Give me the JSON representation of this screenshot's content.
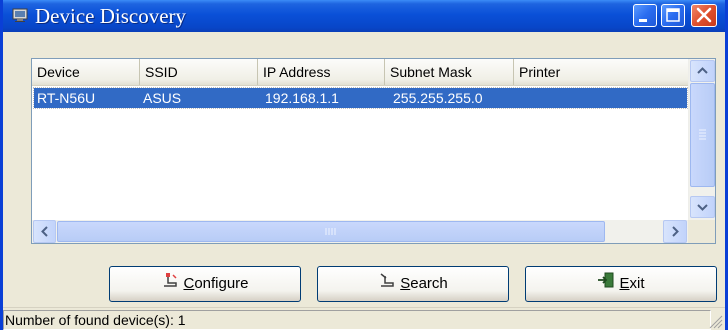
{
  "window": {
    "title": "Device Discovery",
    "icon": "device-discovery-icon",
    "controls": [
      "minimize-icon",
      "maximize-icon",
      "close-icon"
    ]
  },
  "table": {
    "columns": [
      "Device",
      "SSID",
      "IP Address",
      "Subnet Mask",
      "Printer"
    ],
    "rows": [
      {
        "device": "RT-N56U",
        "ssid": "ASUS",
        "ip": "192.168.1.1",
        "subnet": "255.255.255.0",
        "printer": "",
        "selected": true
      }
    ]
  },
  "buttons": {
    "configure": {
      "mnemonic": "C",
      "rest": "onfigure",
      "icon": "configure-icon"
    },
    "search": {
      "mnemonic": "S",
      "rest": "earch",
      "icon": "search-icon"
    },
    "exit": {
      "mnemonic": "E",
      "rest": "xit",
      "icon": "exit-icon"
    }
  },
  "status": {
    "text": "Number of found device(s): 1"
  },
  "colors": {
    "title_bar": "#0a50d8",
    "selection": "#316ac5",
    "close_button": "#e0502e",
    "dialog_bg": "#ece9d8"
  }
}
